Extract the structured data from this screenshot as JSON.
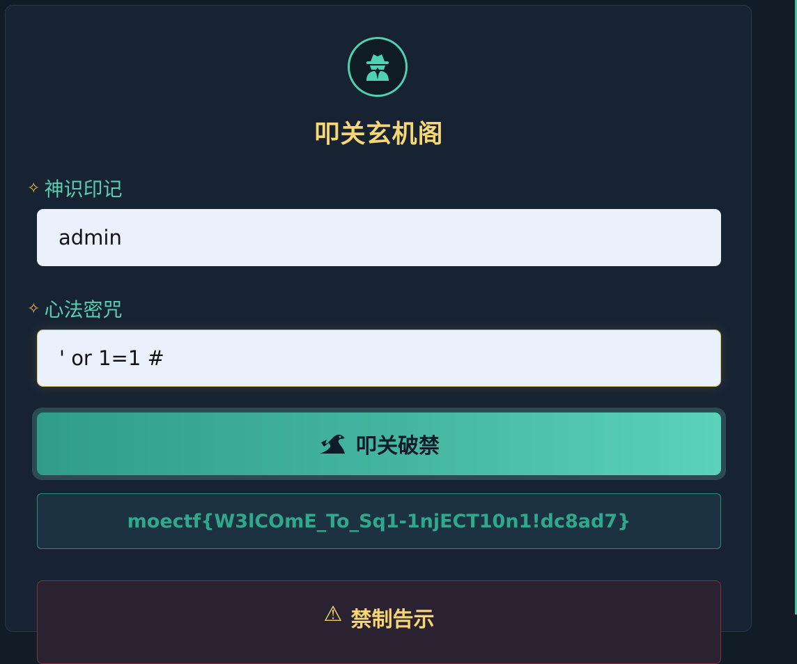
{
  "panel": {
    "emblem_icon": "spy-icon",
    "title": "叩关玄机阁"
  },
  "form": {
    "username": {
      "label": "神识印记",
      "value": "admin",
      "icon": "sparkle-icon"
    },
    "password": {
      "label": "心法密咒",
      "value": "' or 1=1 #",
      "icon": "sparkle-icon"
    },
    "submit": {
      "label": "叩关破禁",
      "icon": "dragon-icon"
    }
  },
  "result": {
    "flag": "moectf{W3lCOmE_To_Sq1-1njECT10n1!dc8ad7}"
  },
  "warning": {
    "icon": "warning-icon",
    "title": "禁制告示"
  },
  "colors": {
    "accent": "#4fd1b3",
    "title_gold": "#f7d774",
    "panel_bg": "#172233"
  }
}
